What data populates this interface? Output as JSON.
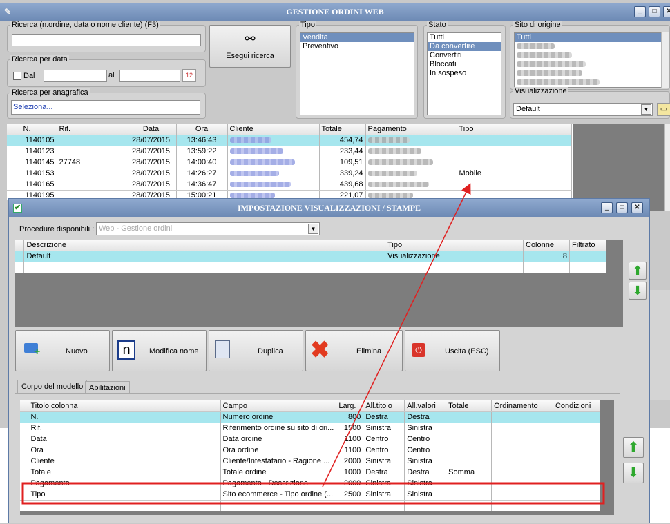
{
  "main": {
    "title": "GESTIONE ORDINI WEB"
  },
  "search": {
    "label": "Ricerca (n.ordine, data o nome cliente) (F3)",
    "value": ""
  },
  "date_search": {
    "label": "Ricerca per data",
    "from_label": "Dal",
    "to_label": "al"
  },
  "registry_search": {
    "label": "Ricerca per anagrafica",
    "value": "Seleziona..."
  },
  "search_button": {
    "label": "Esegui ricerca"
  },
  "tipo": {
    "label": "Tipo",
    "items": [
      "Vendita",
      "Preventivo"
    ]
  },
  "stato": {
    "label": "Stato",
    "items": [
      "Tutti",
      "Da convertire",
      "Convertiti",
      "Bloccati",
      "In sospeso"
    ]
  },
  "sito": {
    "label": "Sito di origine",
    "items": [
      "Tutti"
    ]
  },
  "visualizzazione": {
    "label": "Visualizzazione",
    "value": "Default"
  },
  "orders": {
    "headers": [
      "N.",
      "Rif.",
      "Data",
      "Ora",
      "Cliente",
      "Totale",
      "Pagamento",
      "Tipo"
    ],
    "rows": [
      {
        "n": "1140105",
        "rif": "",
        "data": "28/07/2015",
        "ora": "13:46:43",
        "totale": "454,74",
        "tipo": ""
      },
      {
        "n": "1140123",
        "rif": "",
        "data": "28/07/2015",
        "ora": "13:59:22",
        "totale": "233,44",
        "tipo": ""
      },
      {
        "n": "1140145",
        "rif": "27748",
        "data": "28/07/2015",
        "ora": "14:00:40",
        "totale": "109,51",
        "tipo": ""
      },
      {
        "n": "1140153",
        "rif": "",
        "data": "28/07/2015",
        "ora": "14:26:27",
        "totale": "339,24",
        "tipo": "Mobile"
      },
      {
        "n": "1140165",
        "rif": "",
        "data": "28/07/2015",
        "ora": "14:36:47",
        "totale": "439,68",
        "tipo": ""
      },
      {
        "n": "1140195",
        "rif": "",
        "data": "28/07/2015",
        "ora": "15:00:21",
        "totale": "221,07",
        "tipo": ""
      }
    ]
  },
  "dialog": {
    "title": "IMPOSTAZIONE VISUALIZZAZIONI / STAMPE",
    "procedure_label": "Procedure disponibili :",
    "procedure_value": "Web - Gestione ordini",
    "views": {
      "headers": [
        "Descrizione",
        "Tipo",
        "Colonne",
        "Filtrato"
      ],
      "rows": [
        {
          "descrizione": "Default",
          "tipo": "Visualizzazione",
          "colonne": "8",
          "filtrato": ""
        }
      ]
    },
    "buttons": {
      "nuovo": "Nuovo",
      "modifica": "Modifica nome",
      "duplica": "Duplica",
      "elimina": "Elimina",
      "uscita": "Uscita (ESC)"
    },
    "tabs": [
      "Corpo del modello",
      "Abilitazioni"
    ],
    "columns": {
      "headers": [
        "Titolo colonna",
        "Campo",
        "Larg.",
        "All.titolo",
        "All.valori",
        "Totale",
        "Ordinamento",
        "Condizioni"
      ],
      "rows": [
        {
          "titolo": "N.",
          "campo": "Numero ordine",
          "larg": "800",
          "alltitolo": "Destra",
          "allvalori": "Destra",
          "totale": ""
        },
        {
          "titolo": "Rif.",
          "campo": "Riferimento ordine su sito di ori...",
          "larg": "1500",
          "alltitolo": "Sinistra",
          "allvalori": "Sinistra",
          "totale": ""
        },
        {
          "titolo": "Data",
          "campo": "Data ordine",
          "larg": "1100",
          "alltitolo": "Centro",
          "allvalori": "Centro",
          "totale": ""
        },
        {
          "titolo": "Ora",
          "campo": "Ora ordine",
          "larg": "1100",
          "alltitolo": "Centro",
          "allvalori": "Centro",
          "totale": ""
        },
        {
          "titolo": "Cliente",
          "campo": "Cliente/Intestatario - Ragione ...",
          "larg": "2000",
          "alltitolo": "Sinistra",
          "allvalori": "Sinistra",
          "totale": ""
        },
        {
          "titolo": "Totale",
          "campo": "Totale ordine",
          "larg": "1000",
          "alltitolo": "Destra",
          "allvalori": "Destra",
          "totale": "Somma"
        },
        {
          "titolo": "Pagamento",
          "campo": "Pagamento - Descrizione",
          "larg": "2000",
          "alltitolo": "Sinistra",
          "allvalori": "Sinistra",
          "totale": ""
        },
        {
          "titolo": "Tipo",
          "campo": "Sito ecommerce - Tipo ordine (...",
          "larg": "2500",
          "alltitolo": "Sinistra",
          "allvalori": "Sinistra",
          "totale": ""
        }
      ]
    }
  },
  "colors": {
    "titlebar": "#7b96c0",
    "highlight_row": "#a6e6ee",
    "annotation": "#e02020"
  }
}
